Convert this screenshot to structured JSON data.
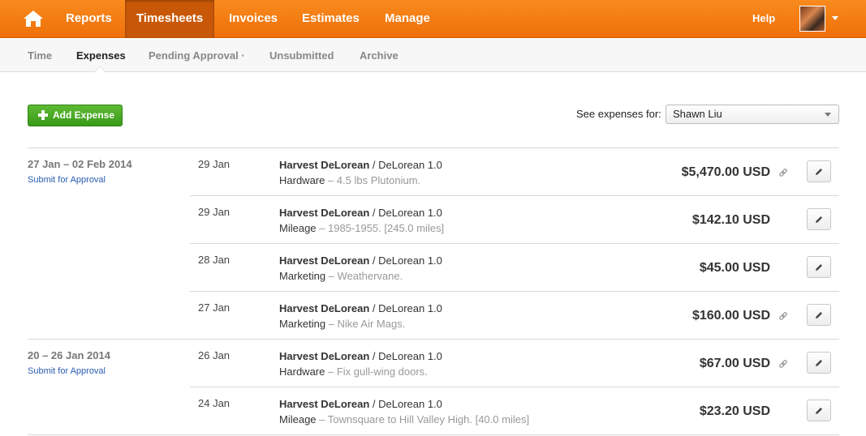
{
  "nav": {
    "items": [
      {
        "label": "Reports",
        "active": false
      },
      {
        "label": "Timesheets",
        "active": true
      },
      {
        "label": "Invoices",
        "active": false
      },
      {
        "label": "Estimates",
        "active": false
      },
      {
        "label": "Manage",
        "active": false
      }
    ],
    "help": "Help",
    "avatar_icon": "user-avatar-icon",
    "accent_color": "#f57e12"
  },
  "subnav": {
    "items": [
      {
        "label": "Time",
        "active": false
      },
      {
        "label": "Expenses",
        "active": true
      },
      {
        "label": "Pending Approval ·",
        "active": false
      },
      {
        "label": "Unsubmitted",
        "active": false
      },
      {
        "label": "Archive",
        "active": false
      }
    ]
  },
  "toolbar": {
    "add_label": "Add Expense",
    "see_label": "See expenses for:",
    "selected_user": "Shawn Liu"
  },
  "weeks": [
    {
      "range": "27 Jan – 02 Feb 2014",
      "submit_label": "Submit for Approval",
      "entries": [
        {
          "date": "29 Jan",
          "client": "Harvest DeLorean",
          "project": " / DeLorean 1.0",
          "category": "Hardware",
          "note": " – 4.5 lbs Plutonium.",
          "amount": "$5,470.00 USD",
          "has_receipt": true
        },
        {
          "date": "29 Jan",
          "client": "Harvest DeLorean",
          "project": " / DeLorean 1.0",
          "category": "Mileage",
          "note": " – 1985-1955. [245.0 miles]",
          "amount": "$142.10 USD",
          "has_receipt": false
        },
        {
          "date": "28 Jan",
          "client": "Harvest DeLorean",
          "project": " / DeLorean 1.0",
          "category": "Marketing",
          "note": " – Weathervane.",
          "amount": "$45.00 USD",
          "has_receipt": false
        },
        {
          "date": "27 Jan",
          "client": "Harvest DeLorean",
          "project": " / DeLorean 1.0",
          "category": "Marketing",
          "note": " – Nike Air Mags.",
          "amount": "$160.00 USD",
          "has_receipt": true
        }
      ]
    },
    {
      "range": "20 – 26 Jan 2014",
      "submit_label": "Submit for Approval",
      "entries": [
        {
          "date": "26 Jan",
          "client": "Harvest DeLorean",
          "project": " / DeLorean 1.0",
          "category": "Hardware",
          "note": " – Fix gull-wing doors.",
          "amount": "$67.00 USD",
          "has_receipt": true
        },
        {
          "date": "24 Jan",
          "client": "Harvest DeLorean",
          "project": " / DeLorean 1.0",
          "category": "Mileage",
          "note": " – Townsquare to Hill Valley High. [40.0 miles]",
          "amount": "$23.20 USD",
          "has_receipt": false
        }
      ]
    }
  ]
}
